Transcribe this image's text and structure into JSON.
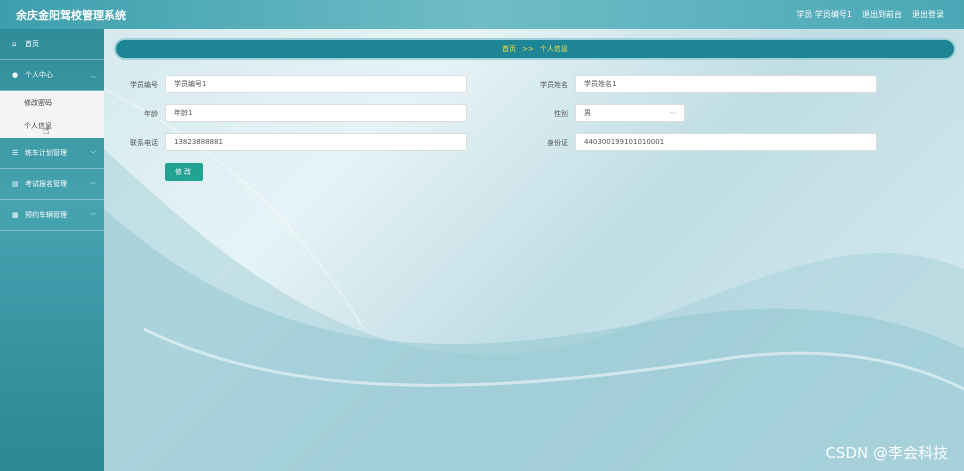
{
  "header": {
    "title": "余庆金阳驾校管理系统",
    "role": "学员",
    "username": "学员编号1",
    "back_link": "退出到前台",
    "logout_link": "退出登录"
  },
  "sidebar": {
    "items": [
      {
        "label": "首页",
        "icon": "home-icon"
      },
      {
        "label": "个人中心",
        "icon": "user-icon"
      },
      {
        "label": "练车计划管理",
        "icon": "list-icon"
      },
      {
        "label": "考试报名管理",
        "icon": "document-icon"
      },
      {
        "label": "预约车辆管理",
        "icon": "grid-icon"
      }
    ],
    "submenu": [
      "修改密码",
      "个人信息"
    ]
  },
  "breadcrumb": {
    "home": "首页",
    "separator": ">>",
    "current": "个人信息"
  },
  "form": {
    "student_no_label": "学员编号",
    "student_no_value": "学员编号1",
    "student_name_label": "学员姓名",
    "student_name_value": "学员姓名1",
    "age_label": "年龄",
    "age_value": "年龄1",
    "gender_label": "性别",
    "gender_value": "男",
    "phone_label": "联系电话",
    "phone_value": "13823888881",
    "id_label": "身份证",
    "id_value": "440300199101010001",
    "submit_label": "修改"
  },
  "watermark": "CSDN @李会科技",
  "colors": {
    "header": "#4aa8b5",
    "breadcrumb": "#1d8593",
    "breadcrumb_text": "#f4e04d",
    "button": "#21a393"
  }
}
